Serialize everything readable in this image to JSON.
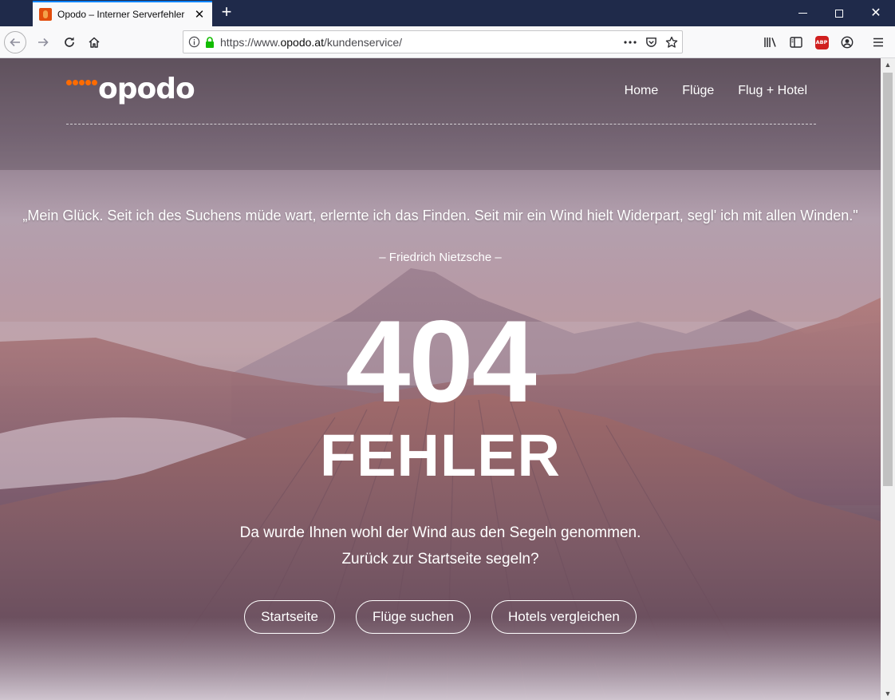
{
  "browser": {
    "tab_title": "Opodo – Interner Serverfehler",
    "url_prefix": "https://www.",
    "url_host": "opodo.at",
    "url_path": "/kundenservice/",
    "icons": [
      "back-icon",
      "forward-icon",
      "reload-icon",
      "home-icon",
      "info-icon",
      "lock-icon",
      "more-icon",
      "pocket-icon",
      "bookmark-star-icon",
      "library-icon",
      "sidebar-icon",
      "adblock-icon",
      "account-icon",
      "menu-icon"
    ],
    "abp_label": "ABP"
  },
  "site": {
    "logo_text": "opodo",
    "nav": [
      "Home",
      "Flüge",
      "Flug + Hotel"
    ],
    "accent": "#ff6b00"
  },
  "content": {
    "quote": "„Mein Glück. Seit ich des Suchens müde wart, erlernte ich das Finden. Seit mir ein Wind hielt Widerpart, segl' ich mit allen Winden.\"",
    "author": "– Friedrich Nietzsche –",
    "error_code": "404",
    "error_word": "FEHLER",
    "message_1": "Da wurde Ihnen wohl der Wind aus den Segeln genommen.",
    "message_2": "Zurück zur Startseite segeln?",
    "buttons": [
      "Startseite",
      "Flüge suchen",
      "Hotels vergleichen"
    ]
  }
}
